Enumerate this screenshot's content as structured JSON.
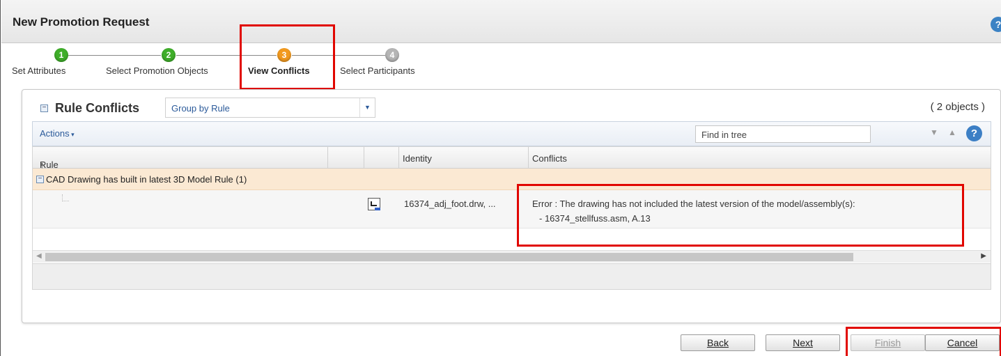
{
  "window": {
    "title": "New Promotion Request",
    "help_icon": "?"
  },
  "wizard": {
    "steps": [
      {
        "number": "1",
        "label": "Set Attributes",
        "color": "#3fae2a"
      },
      {
        "number": "2",
        "label": "Select Promotion Objects",
        "color": "#3fae2a"
      },
      {
        "number": "3",
        "label": "View Conflicts",
        "color": "#f29a1f"
      },
      {
        "number": "4",
        "label": "Select Participants",
        "color": "#b5b5b5"
      }
    ]
  },
  "panel": {
    "title": "Rule Conflicts",
    "group_by": "Group by Rule",
    "count": "( 2 objects )",
    "toolbar": {
      "actions_label": "Actions",
      "find_placeholder": "Find in tree"
    },
    "columns": [
      "Rule Name",
      "",
      "",
      "Identity",
      "Conflicts"
    ],
    "sort_indicator": "↑",
    "group_row": "CAD Drawing has built in latest 3D Model Rule (1)",
    "row": {
      "identity": "16374_adj_foot.drw, ...",
      "conflict_line1": "Error : The drawing has not included the latest version of the model/assembly(s):",
      "conflict_line2": "- 16374_stellfuss.asm, A.13"
    }
  },
  "buttons": {
    "back": "Back",
    "next": "Next",
    "finish": "Finish",
    "cancel": "Cancel"
  },
  "colors": {
    "highlight": "#e10600",
    "group_row_bg": "#fbe9d3",
    "link": "#2b5a9a"
  }
}
